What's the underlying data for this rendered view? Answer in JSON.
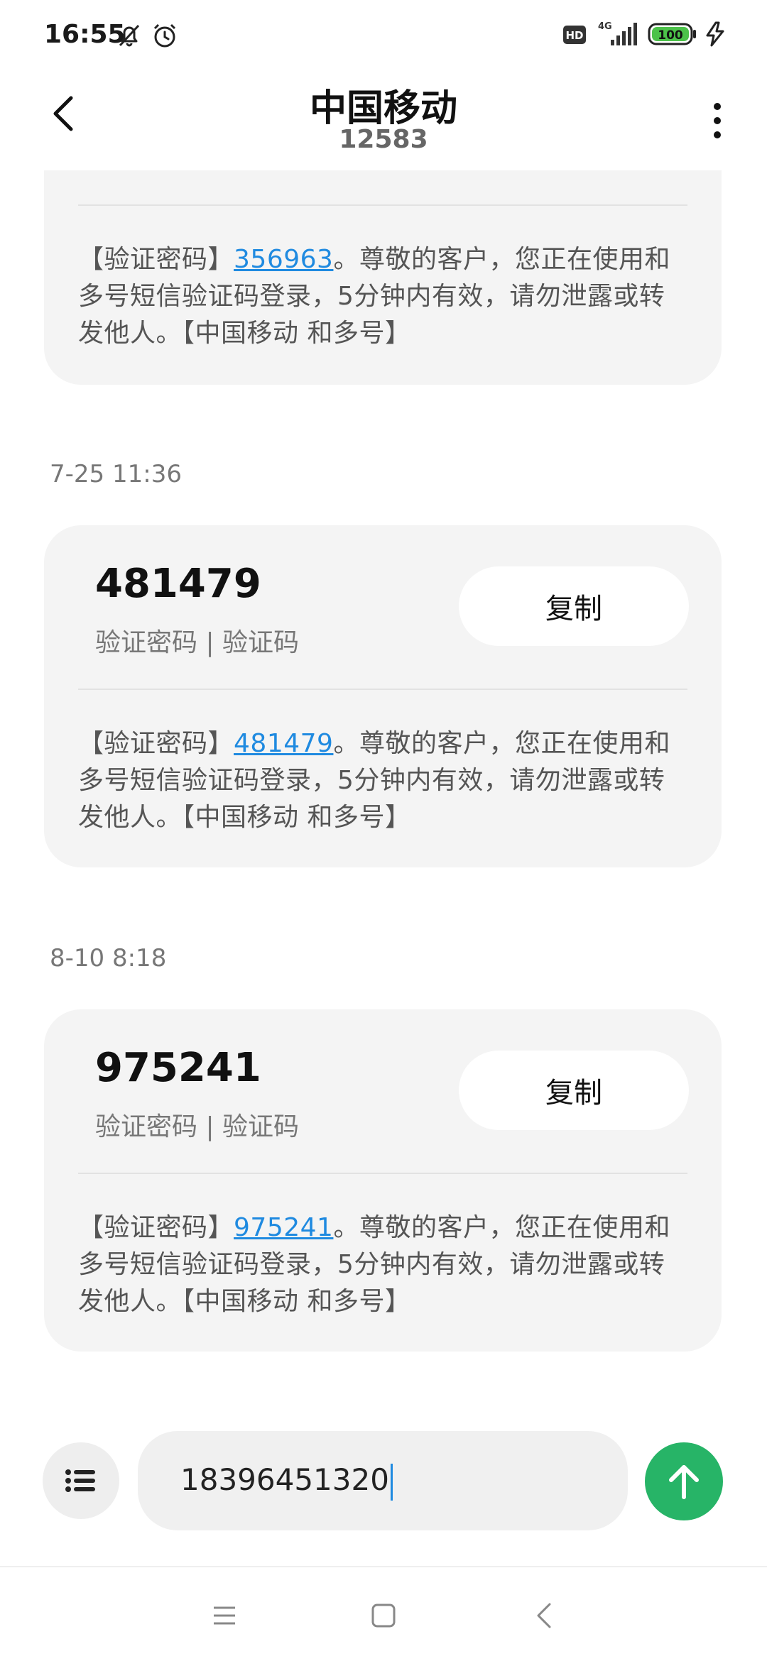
{
  "status_bar": {
    "time": "16:55",
    "icons": [
      "mute-bell-icon",
      "alarm-icon",
      "hd-icon",
      "4g-signal-icon",
      "battery-icon",
      "charging-icon"
    ],
    "network_label": "4G",
    "hd_label": "HD",
    "battery_level": "100"
  },
  "header": {
    "title": "中国移动",
    "subtitle": "12583"
  },
  "messages": [
    {
      "text_prefix": "【验证密码】",
      "code": "356963",
      "text_suffix": "。尊敬的客户，您正在使用和多号短信验证码登录，5分钟内有效，请勿泄露或转发他人。【中国移动 和多号】"
    },
    {
      "timestamp": "7-25 11:36",
      "big_code": "481479",
      "caption": "验证密码 | 验证码",
      "copy_label": "复制",
      "text_prefix": "【验证密码】",
      "code": "481479",
      "text_suffix": "。尊敬的客户，您正在使用和多号短信验证码登录，5分钟内有效，请勿泄露或转发他人。【中国移动 和多号】"
    },
    {
      "timestamp": "8-10 8:18",
      "big_code": "975241",
      "caption": "验证密码 | 验证码",
      "copy_label": "复制",
      "text_prefix": "【验证密码】",
      "code": "975241",
      "text_suffix": "。尊敬的客户，您正在使用和多号短信验证码登录，5分钟内有效，请勿泄露或转发他人。【中国移动 和多号】"
    }
  ],
  "composer": {
    "input_value": "18396451320"
  },
  "colors": {
    "link": "#1f8ae0",
    "send": "#27b467",
    "bubble": "#f4f4f4"
  }
}
